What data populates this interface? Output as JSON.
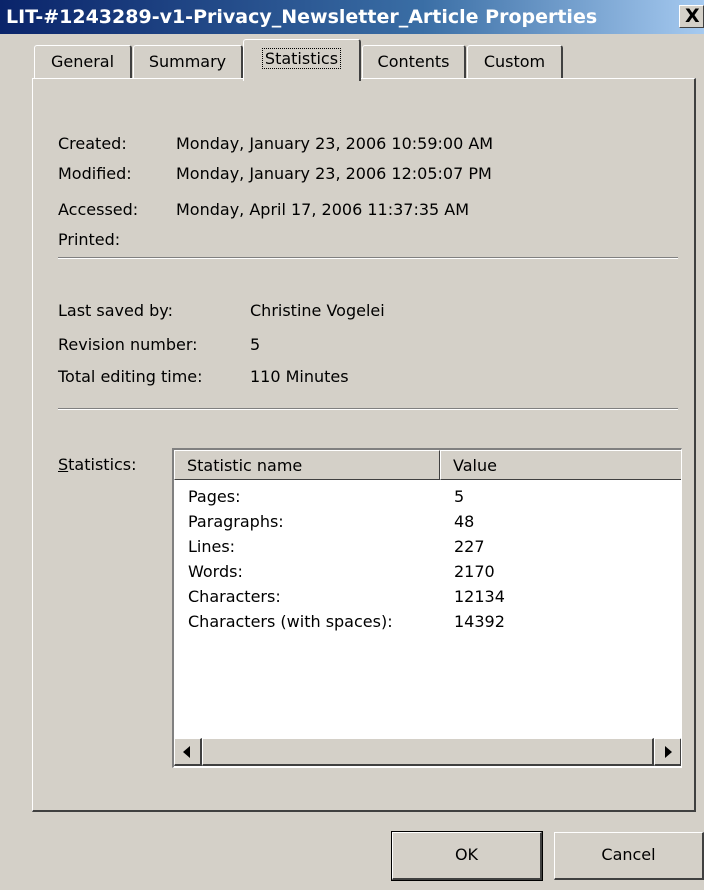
{
  "window": {
    "title": "LIT-#1243289-v1-Privacy_Newsletter_Article Properties",
    "close_glyph": "X"
  },
  "tabs": [
    {
      "label": "General"
    },
    {
      "label": "Summary"
    },
    {
      "label": "Statistics",
      "active": true
    },
    {
      "label": "Contents"
    },
    {
      "label": "Custom"
    }
  ],
  "dates": {
    "created_label": "Created:",
    "created_value": "Monday, January 23, 2006 10:59:00 AM",
    "modified_label": "Modified:",
    "modified_value": "Monday, January 23, 2006 12:05:07 PM",
    "accessed_label": "Accessed:",
    "accessed_value": "Monday, April 17, 2006 11:37:35 AM",
    "printed_label": "Printed:",
    "printed_value": ""
  },
  "info": {
    "last_saved_label": "Last saved by:",
    "last_saved_value": "Christine Vogelei",
    "revision_label": "Revision number:",
    "revision_value": "5",
    "editing_label": "Total editing time:",
    "editing_value": "110 Minutes"
  },
  "statistics": {
    "label_hotkey": "S",
    "label_rest": "tatistics:",
    "columns": [
      "Statistic name",
      "Value"
    ],
    "rows": [
      {
        "name": "Pages:",
        "value": "5"
      },
      {
        "name": "Paragraphs:",
        "value": "48"
      },
      {
        "name": "Lines:",
        "value": "227"
      },
      {
        "name": "Words:",
        "value": "2170"
      },
      {
        "name": "Characters:",
        "value": "12134"
      },
      {
        "name": "Characters (with spaces):",
        "value": "14392"
      }
    ]
  },
  "buttons": {
    "ok": "OK",
    "cancel": "Cancel"
  }
}
